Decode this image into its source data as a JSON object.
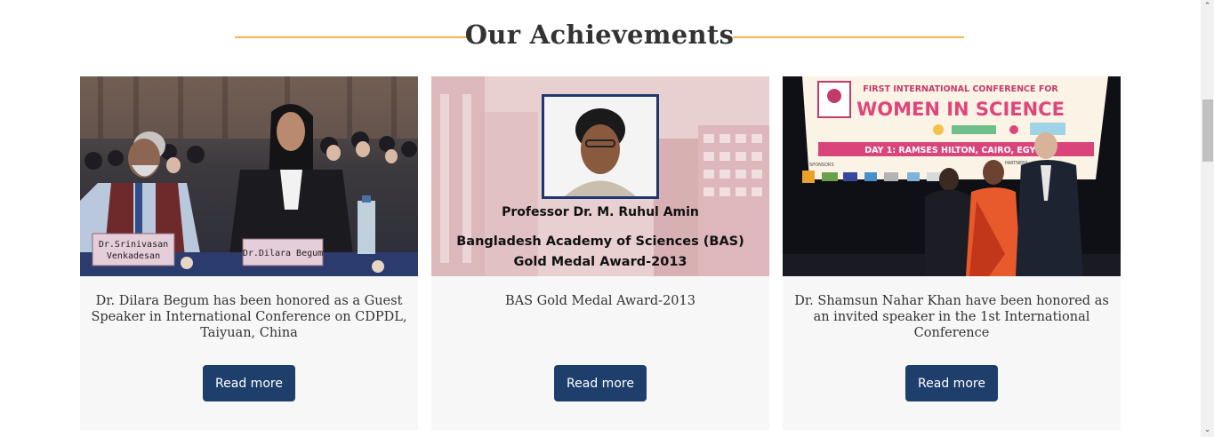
{
  "section": {
    "title": "Our Achievements"
  },
  "cards": [
    {
      "text": "Dr. Dilara Begum has been honored as a Guest Speaker in International Conference on CDPDL, Taiyuan, China",
      "button": "Read more",
      "image": {
        "placard_left": [
          "Dr.Srinivasan",
          "Venkadesan"
        ],
        "placard_right": "Dr.Dilara Begum"
      }
    },
    {
      "text": "BAS Gold Medal Award-2013",
      "button": "Read more",
      "image": {
        "caption_name": "Professor Dr. M. Ruhul Amin",
        "caption_line1": "Bangladesh Academy of Sciences (BAS)",
        "caption_line2": "Gold Medal Award-2013"
      }
    },
    {
      "text": "Dr. Shamsun Nahar Khan have been honored as an invited speaker in the 1st International Conference",
      "button": "Read more",
      "image": {
        "banner_top": "FIRST INTERNATIONAL CONFERENCE FOR",
        "banner_main": "WOMEN IN SCIENCE",
        "banner_day": "DAY 1: RAMSES HILTON, CAIRO, EGYPT",
        "banner_sponsors": "SPONSORS",
        "banner_partners": "PARTNERS"
      }
    }
  ],
  "colors": {
    "accent_line": "#f3b54a",
    "button_bg": "#1e3f6b",
    "card_bg": "#f7f7f7"
  },
  "scrollbar": {
    "up_icon": "chevron-up-icon",
    "down_icon": "chevron-down-icon"
  }
}
